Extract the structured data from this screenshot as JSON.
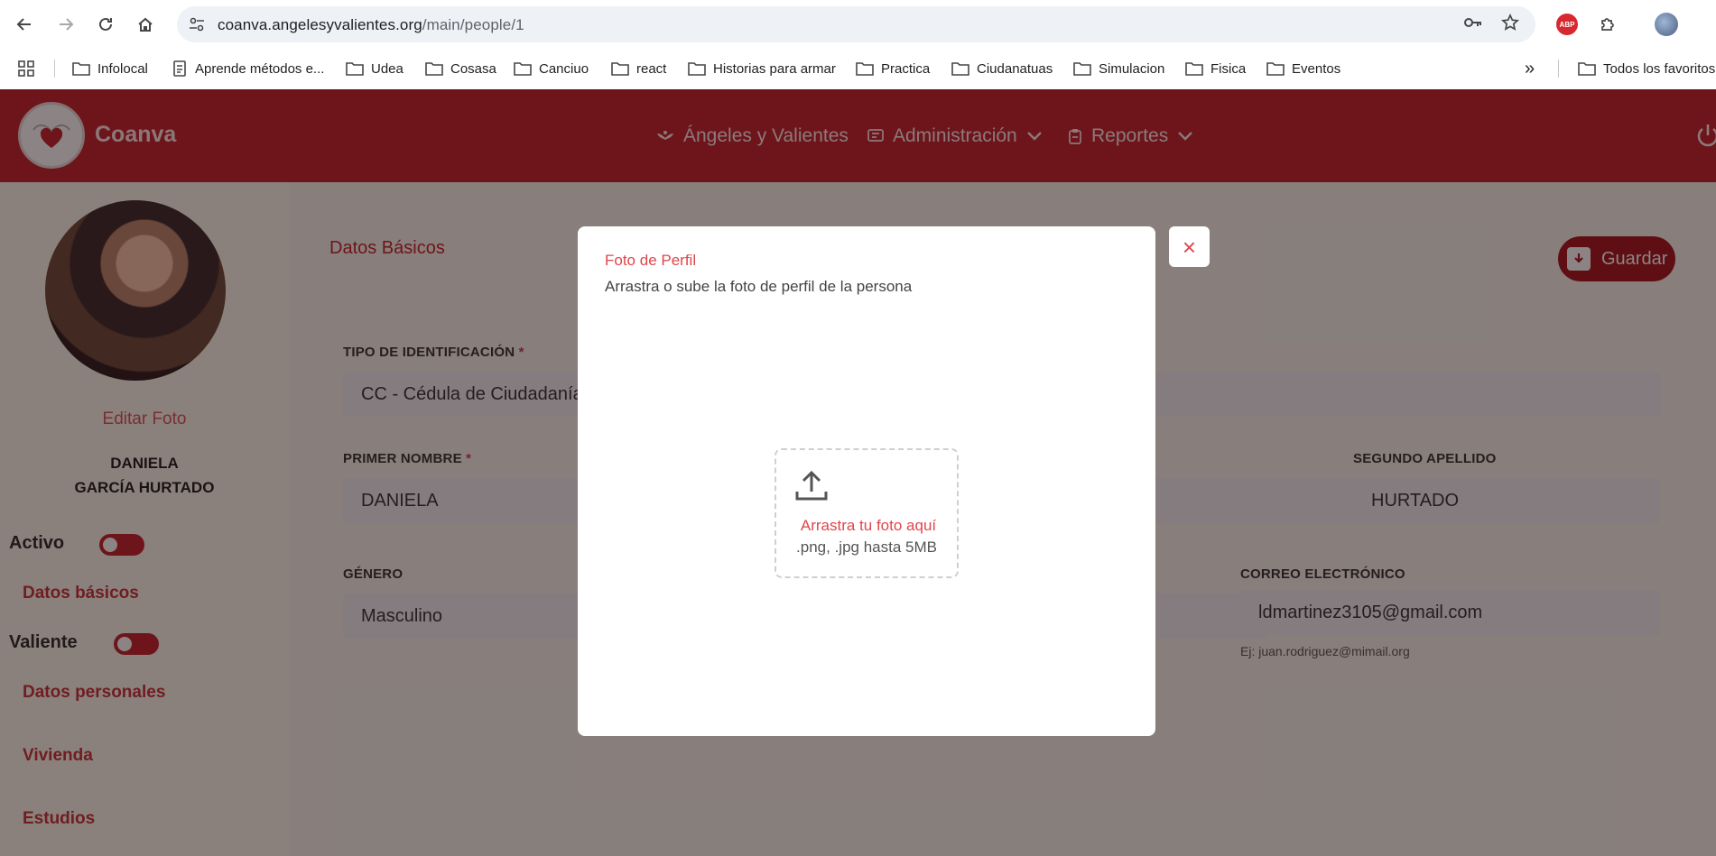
{
  "browser": {
    "url_host": "coanva.angelesyvalientes.org",
    "url_path": "/main/people/1",
    "abp_label": "ABP",
    "bookmarks": [
      {
        "label": "Infolocal",
        "icon": "folder-icon"
      },
      {
        "label": "Aprende métodos e...",
        "icon": "page-icon"
      },
      {
        "label": "Udea",
        "icon": "folder-icon"
      },
      {
        "label": "Cosasa",
        "icon": "folder-icon"
      },
      {
        "label": "Canciuo",
        "icon": "folder-icon"
      },
      {
        "label": "react",
        "icon": "folder-icon"
      },
      {
        "label": "Historias para armar",
        "icon": "folder-icon"
      },
      {
        "label": "Practica",
        "icon": "folder-icon"
      },
      {
        "label": "Ciudanatuas",
        "icon": "folder-icon"
      },
      {
        "label": "Simulacion",
        "icon": "folder-icon"
      },
      {
        "label": "Fisica",
        "icon": "folder-icon"
      },
      {
        "label": "Eventos",
        "icon": "folder-icon"
      }
    ],
    "overflow_label": "»",
    "all_bookmarks_label": "Todos los favoritos"
  },
  "header": {
    "brand": "Coanva",
    "menu": [
      {
        "label": "Ángeles y Valientes",
        "icon": "angel-icon"
      },
      {
        "label": "Administración",
        "icon": "admin-icon"
      },
      {
        "label": "Reportes",
        "icon": "clipboard-icon"
      }
    ]
  },
  "sidebar": {
    "edit_photo": "Editar Foto",
    "first_name": "DANIELA",
    "last_names": "GARCÍA HURTADO",
    "active_label": "Activo",
    "basic_data_link": "Datos básicos",
    "brave_label": "Valiente",
    "links": [
      "Datos personales",
      "Vivienda",
      "Estudios"
    ]
  },
  "main": {
    "tab_title": "Datos Básicos",
    "save_label": "Guardar",
    "id_type_label": "TIPO DE IDENTIFICACIÓN",
    "id_type_value": "CC - Cédula de Ciudadanía",
    "first_name_label": "PRIMER NOMBRE",
    "first_name_value": "DANIELA",
    "second_lastname_label": "SEGUNDO APELLIDO",
    "second_lastname_value": "HURTADO",
    "gender_label": "GÉNERO",
    "gender_value": "Masculino",
    "email_label": "CORREO ELECTRÓNICO",
    "email_value": "ldmartinez3105@gmail.com",
    "email_hint": "Ej: juan.rodriguez@mimail.org",
    "required_mark": "*"
  },
  "modal": {
    "title": "Foto de Perfil",
    "description": "Arrastra o sube la foto de perfil de la persona",
    "drop_main": "Arrastra tu foto aquí",
    "drop_sub": ".png, .jpg hasta 5MB",
    "close_label": "×"
  },
  "colors": {
    "brand": "#c0232b",
    "accent_text": "#e0454b"
  }
}
